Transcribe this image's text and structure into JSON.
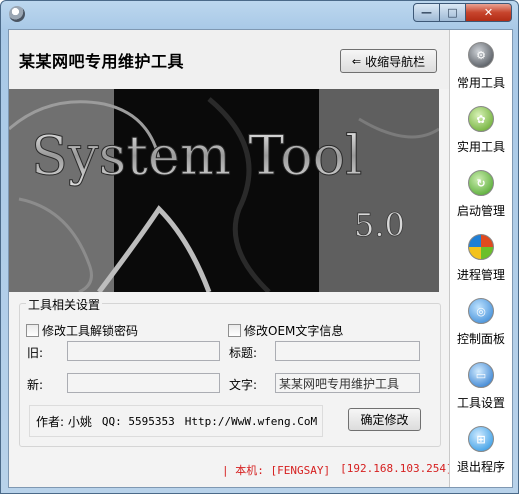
{
  "window": {
    "min_glyph": "—",
    "max_glyph": "□",
    "close_glyph": "✕"
  },
  "header": {
    "title": "某某网吧专用维护工具",
    "collapse_button": "收缩导航栏",
    "collapse_arrow": "⇐"
  },
  "banner": {
    "logo_text": "System Tool",
    "version": "5.0"
  },
  "settings": {
    "group_title": "工具相关设置",
    "unlock_checkbox": "修改工具解锁密码",
    "oem_checkbox": "修改OEM文字信息",
    "old_label": "旧:",
    "new_label": "新:",
    "title_label": "标题:",
    "text_label": "文字:",
    "old_value": "",
    "new_value": "",
    "title_value": "",
    "text_value": "某某网吧专用维护工具",
    "author": "作者: 小姚",
    "qq": "QQ: 5595353",
    "url": "Http://WwW.wfeng.CoM",
    "confirm_button": "确定修改"
  },
  "status": {
    "machine": "| 本机: [FENGSAY]",
    "ip": "[192.168.103.254]"
  },
  "sidebar": {
    "items": [
      {
        "label": "常用工具",
        "icon": "gear-ball-icon",
        "color": "#3a3f46"
      },
      {
        "label": "实用工具",
        "icon": "green-gear-icon",
        "color": "#5aa21f"
      },
      {
        "label": "启动管理",
        "icon": "refresh-icon",
        "color": "#3f9e1c"
      },
      {
        "label": "进程管理",
        "icon": "windows-logo-icon",
        "color": "#e04a1f"
      },
      {
        "label": "控制面板",
        "icon": "globe-icon",
        "color": "#2c7fd1"
      },
      {
        "label": "工具设置",
        "icon": "monitor-icon",
        "color": "#1b6ec9"
      },
      {
        "label": "退出程序",
        "icon": "windows-flag-icon",
        "color": "#1e8fe0"
      }
    ]
  }
}
